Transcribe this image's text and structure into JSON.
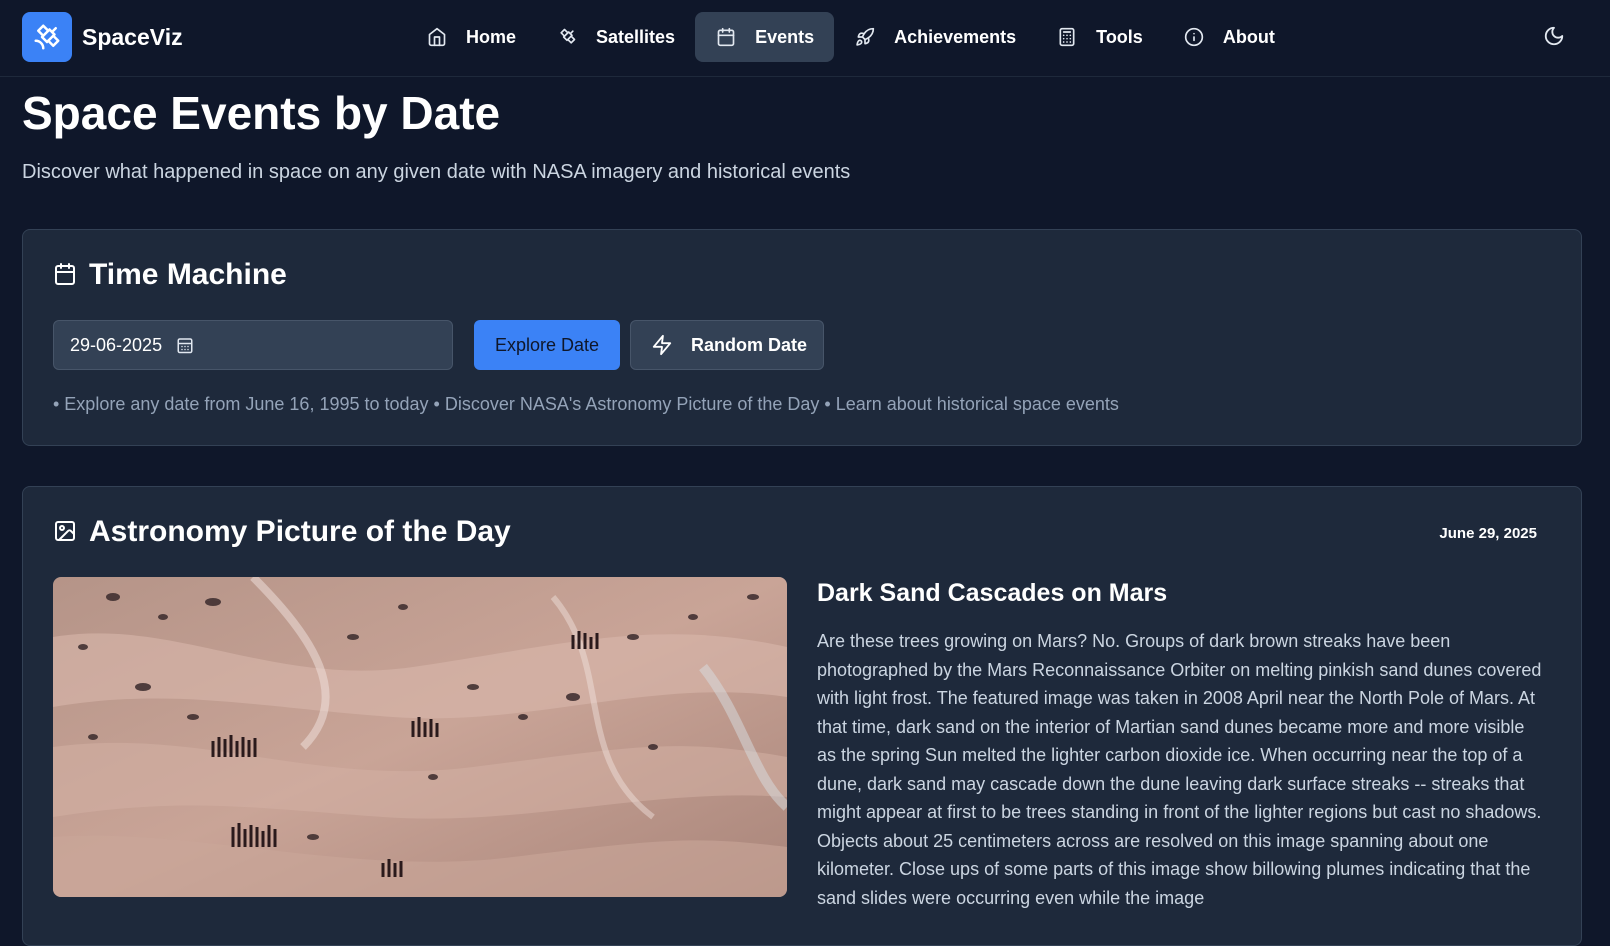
{
  "brand": {
    "name": "SpaceViz",
    "color": "#3b82f6"
  },
  "nav": {
    "items": [
      {
        "label": "Home",
        "icon": "home-icon",
        "active": false
      },
      {
        "label": "Satellites",
        "icon": "satellite-icon",
        "active": false
      },
      {
        "label": "Events",
        "icon": "calendar-icon",
        "active": true
      },
      {
        "label": "Achievements",
        "icon": "rocket-icon",
        "active": false
      },
      {
        "label": "Tools",
        "icon": "calculator-icon",
        "active": false
      },
      {
        "label": "About",
        "icon": "info-icon",
        "active": false
      }
    ],
    "theme_icon": "moon-icon"
  },
  "header": {
    "title": "Space Events by Date",
    "subtitle": "Discover what happened in space on any given date with NASA imagery and historical events"
  },
  "time_machine": {
    "title": "Time Machine",
    "date_value": "29-06-2025",
    "explore_label": "Explore Date",
    "random_label": "Random Date",
    "hints": "• Explore any date from June 16, 1995 to today • Discover NASA's Astronomy Picture of the Day • Learn about historical space events"
  },
  "apod": {
    "section_title": "Astronomy Picture of the Day",
    "date": "June 29, 2025",
    "title": "Dark Sand Cascades on Mars",
    "explanation": "Are these trees growing on Mars? No. Groups of dark brown streaks have been photographed by the Mars Reconnaissance Orbiter on melting pinkish sand dunes covered with light frost. The featured image was taken in 2008 April near the North Pole of Mars. At that time, dark sand on the interior of Martian sand dunes became more and more visible as the spring Sun melted the lighter carbon dioxide ice. When occurring near the top of a dune, dark sand may cascade down the dune leaving dark surface streaks -- streaks that might appear at first to be trees standing in front of the lighter regions but cast no shadows. Objects about 25 centimeters across are resolved on this image spanning about one kilometer. Close ups of some parts of this image show billowing plumes indicating that the sand slides were occurring even while the image"
  }
}
